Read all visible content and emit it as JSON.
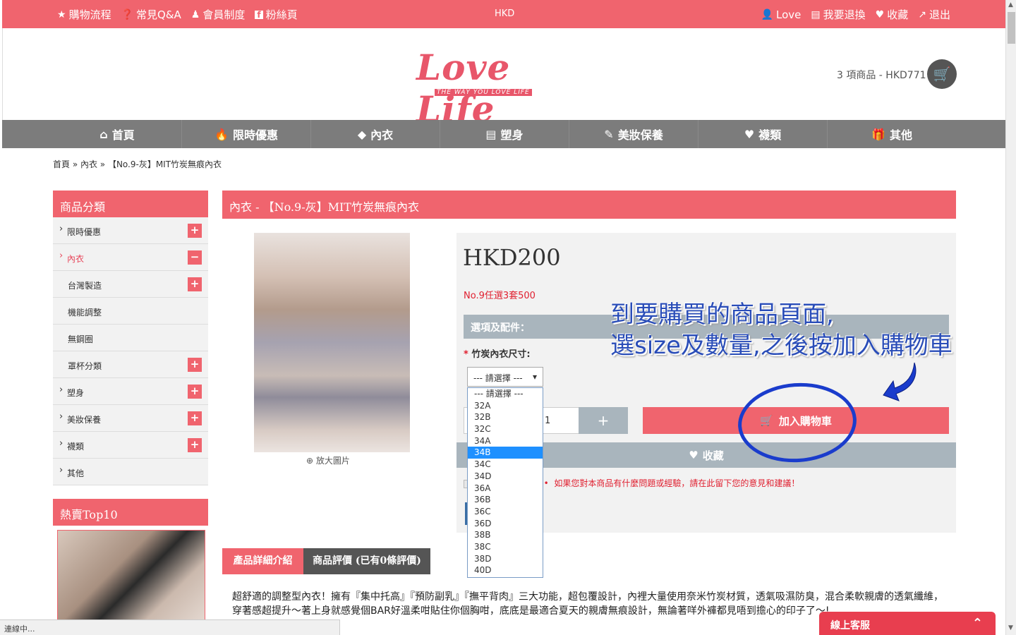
{
  "topbar": {
    "left": [
      {
        "icon": "star-icon",
        "label": "購物流程"
      },
      {
        "icon": "question-icon",
        "label": "常見Q&A"
      },
      {
        "icon": "member-icon",
        "label": "會員制度"
      },
      {
        "icon": "facebook-icon",
        "label": "粉絲頁"
      }
    ],
    "currency": "HKD",
    "right": [
      {
        "icon": "user-icon",
        "label": "Love"
      },
      {
        "icon": "document-icon",
        "label": "我要退換"
      },
      {
        "icon": "heart-icon",
        "label": "收藏"
      },
      {
        "icon": "external-link-icon",
        "label": "退出"
      }
    ]
  },
  "header": {
    "logo_text": "Love Life",
    "logo_tagline": "THE WAY YOU LOVE LIFE",
    "cart_summary": "3 項商品 - HKD771"
  },
  "nav": [
    {
      "icon": "home-icon",
      "label": "首頁"
    },
    {
      "icon": "flame-icon",
      "label": "限時優惠"
    },
    {
      "icon": "diamond-icon",
      "label": "內衣"
    },
    {
      "icon": "list-icon",
      "label": "塑身"
    },
    {
      "icon": "pencil-icon",
      "label": "美妝保養"
    },
    {
      "icon": "heart-icon",
      "label": "襪類"
    },
    {
      "icon": "gift-icon",
      "label": "其他"
    }
  ],
  "breadcrumb": "首頁 » 內衣 » 【No.9-灰】MIT竹炭無痕內衣",
  "sidebar": {
    "title": "商品分類",
    "items": [
      {
        "label": "限時優惠",
        "toggle": "+"
      },
      {
        "label": "內衣",
        "toggle": "−"
      },
      {
        "label": "台灣製造",
        "toggle": "+"
      },
      {
        "label": "機能調整",
        "toggle": ""
      },
      {
        "label": "無鋼圈",
        "toggle": ""
      },
      {
        "label": "罩杯分類",
        "toggle": "+"
      },
      {
        "label": "塑身",
        "toggle": "+"
      },
      {
        "label": "美妝保養",
        "toggle": "+"
      },
      {
        "label": "襪類",
        "toggle": "+"
      },
      {
        "label": "其他",
        "toggle": ""
      }
    ],
    "top10_title": "熱賣Top10"
  },
  "product": {
    "heading": "內衣 - 【No.9-灰】MIT竹炭無痕內衣",
    "zoom_label": "放大圖片",
    "price": "HKD200",
    "promo": "No.9任選3套500",
    "options_title": "選項及配件：",
    "size_label": "竹炭內衣尺寸:",
    "select_value": "--- 請選擇 ---",
    "size_options": [
      "--- 請選擇 ---",
      "32A",
      "32B",
      "32C",
      "34A",
      "34B",
      "34C",
      "34D",
      "36A",
      "36B",
      "36C",
      "36D",
      "38B",
      "38C",
      "38D",
      "40D"
    ],
    "selected_option": "34B",
    "quantity": "1",
    "plus_label": "+",
    "add_to_cart": "加入購物車",
    "favorite": "收藏",
    "review_link": "評價",
    "review_note": "如果您對本商品有什麼問題或經驗，請在此留下您的意見和建議！"
  },
  "annotation": {
    "line1": "到要購買的商品頁面,",
    "line2": "選size及數量,之後按加入購物車",
    "color": "#2a4db8"
  },
  "tabs": [
    {
      "label": "產品詳細介紹"
    },
    {
      "label": "商品評價 (已有0條評價)"
    }
  ],
  "description": "超舒適的調整型內衣！擁有『集中托高』『預防副乳』『撫平背肉』三大功能，超包覆設計，內裡大量使用奈米竹炭材質，透氣吸濕防臭，混合柔軟親膚的透氣纖維，穿著感超提升～著上身就感覺個BAR好溫柔咁貼住你個胸咁，底底是最適合夏天的親膚無痕設計，無論著咩外褲都見唔到擔心的印子了～!",
  "statusbar": "連線中...",
  "chat": {
    "label": "線上客服"
  },
  "colors": {
    "brand": "#f0646e",
    "nav": "#7c7c7c",
    "option_bar": "#a9b5bd",
    "highlight": "#1e90ff"
  }
}
